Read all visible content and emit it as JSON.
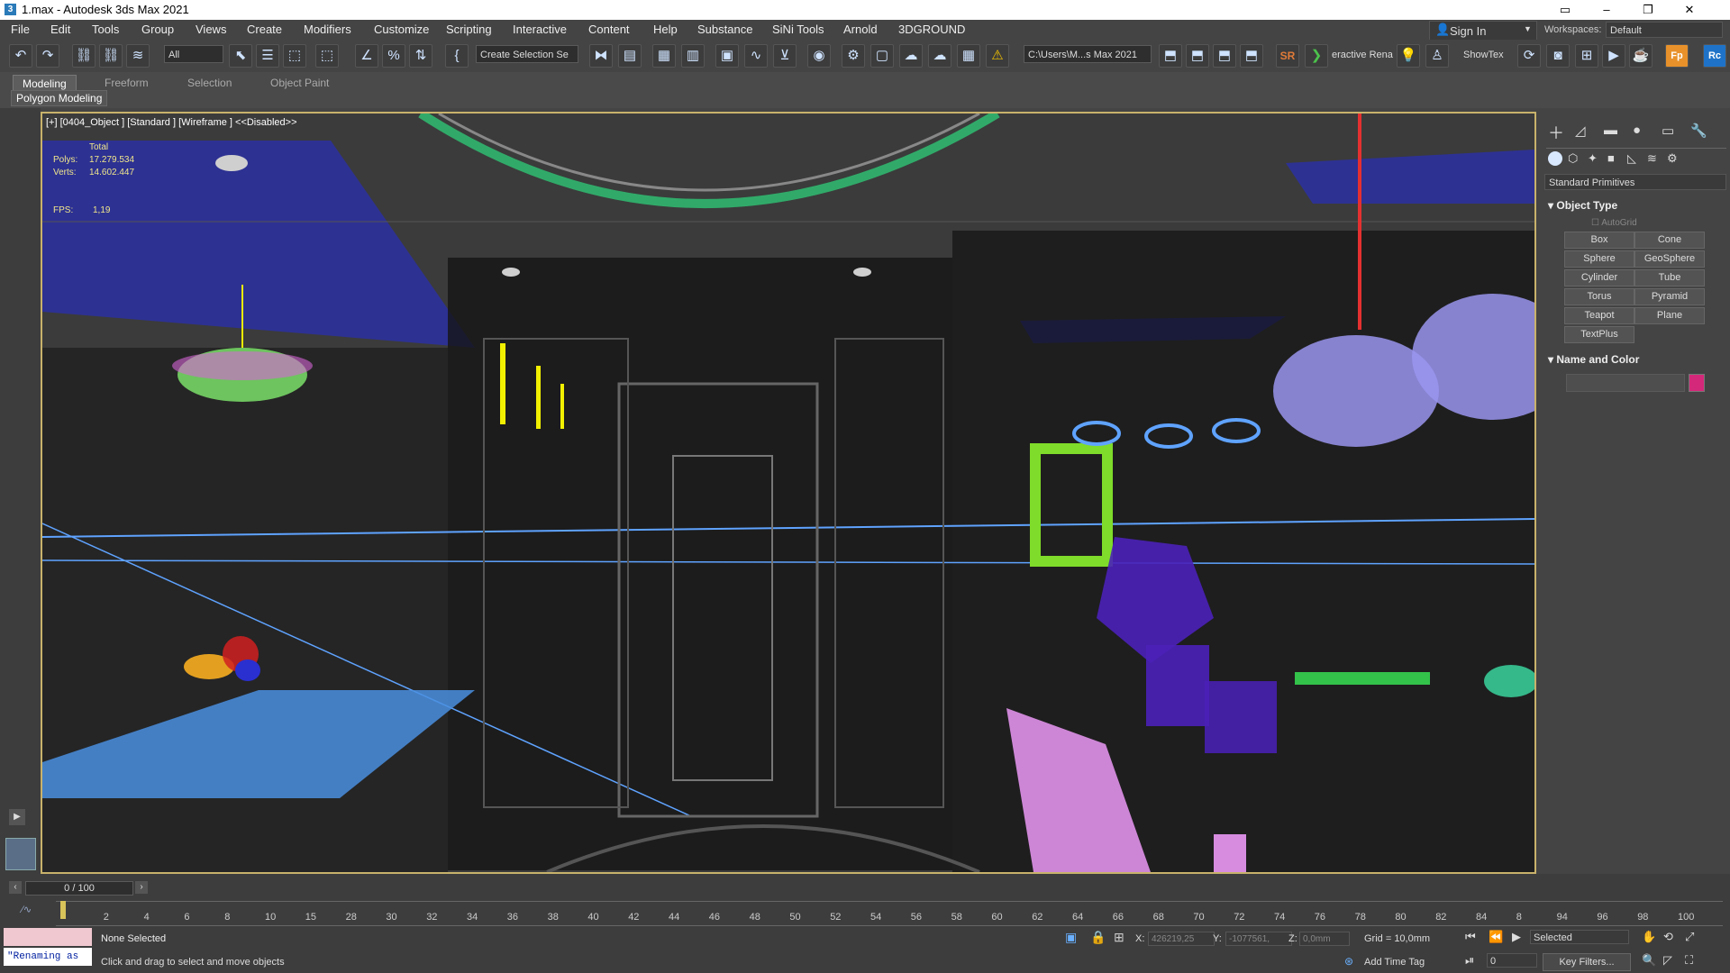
{
  "window": {
    "title": "1.max - Autodesk 3ds Max 2021"
  },
  "menu": [
    "File",
    "Edit",
    "Tools",
    "Group",
    "Views",
    "Create",
    "Modifiers",
    "Customize",
    "Scripting",
    "Interactive",
    "Content",
    "Help",
    "Substance",
    "SiNi Tools",
    "Arnold",
    "3DGROUND"
  ],
  "account": {
    "sign_in": "Sign In",
    "workspaces_label": "Workspaces:",
    "workspace": "Default"
  },
  "toolbar": {
    "filter": "All",
    "create_selection_set": "Create Selection Se",
    "project_path": "C:\\Users\\M...s Max 2021",
    "interactive_render": "eractive Rena",
    "showtex": "ShowTex"
  },
  "ribbon": {
    "tabs": [
      "Modeling",
      "Freeform",
      "Selection",
      "Object Paint"
    ],
    "active": "Modeling",
    "sub": "Polygon Modeling"
  },
  "viewport": {
    "label": "[+] [0404_Object ] [Standard ] [Wireframe ]  <<Disabled>>",
    "stats_total": "Total",
    "polys_label": "Polys:",
    "polys": "17.279.534",
    "verts_label": "Verts:",
    "verts": "14.602.447",
    "fps_label": "FPS:",
    "fps": "1,19"
  },
  "panel": {
    "category": "Standard Primitives",
    "object_type": "Object Type",
    "autogrid": "AutoGrid",
    "buttons": [
      "Box",
      "Cone",
      "Sphere",
      "GeoSphere",
      "Cylinder",
      "Tube",
      "Torus",
      "Pyramid",
      "Teapot",
      "Plane",
      "TextPlus"
    ],
    "name_and_color": "Name and Color",
    "swatch_color": "#d4287a"
  },
  "timeline": {
    "frame": "0 / 100",
    "ticks": [
      "0",
      "2",
      "4",
      "6",
      "8",
      "10",
      "15",
      "28",
      "30",
      "32",
      "34",
      "36",
      "38",
      "40",
      "42",
      "44",
      "46",
      "48",
      "50",
      "52",
      "54",
      "56",
      "58",
      "60",
      "62",
      "64",
      "66",
      "68",
      "70",
      "72",
      "74",
      "76",
      "78",
      "80",
      "82",
      "84",
      "8",
      "94",
      "96",
      "98",
      "100"
    ]
  },
  "status": {
    "renaming": "\"Renaming as",
    "none_selected": "None Selected",
    "hint": "Click and drag to select and move objects",
    "x_label": "X:",
    "x": "426219,25",
    "y_label": "Y:",
    "y": "-1077561,",
    "z_label": "Z:",
    "z": "0,0mm",
    "grid": "Grid = 10,0mm",
    "add_time_tag": "Add Time Tag",
    "selected": "Selected",
    "key_filters": "Key Filters...",
    "frame_value": "0"
  }
}
